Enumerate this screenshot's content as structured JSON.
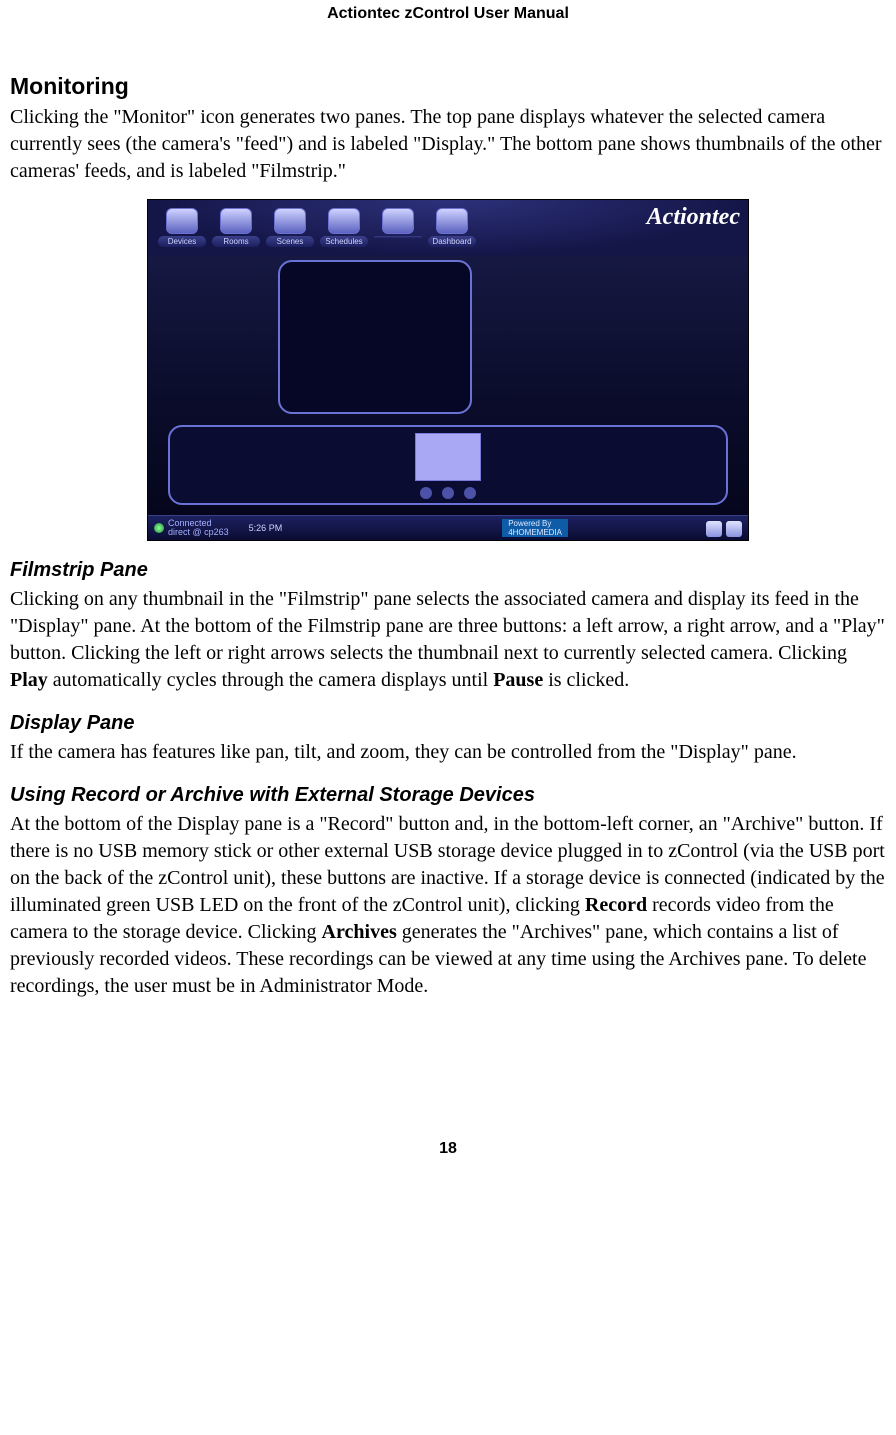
{
  "header": {
    "running_title": "Actiontec zControl User Manual"
  },
  "section": {
    "title": "Monitoring",
    "intro": "Clicking the \"Monitor\" icon generates two panes. The top pane displays whatever the selected camera currently sees (the camera's \"feed\") and is labeled \"Display.\" The bottom pane shows thumbnails of the other cameras' feeds, and is labeled \"Filmstrip.\""
  },
  "screenshot": {
    "brand": "Actiontec",
    "toolbar": [
      "Devices",
      "Rooms",
      "Scenes",
      "Schedules",
      " ",
      "Dashboard"
    ],
    "status": {
      "line1": "Connected",
      "line2": "direct @ cp263",
      "time": "5:26 PM",
      "powered_label": "Powered By",
      "powered_name": "4HOMEMEDIA"
    }
  },
  "filmstrip": {
    "title": "Filmstrip Pane",
    "para_a": "Clicking on any thumbnail in the \"Filmstrip\" pane selects the associated camera and display its feed in the \"Display\" pane. At the bottom of the Filmstrip pane are three buttons: a left arrow, a right arrow, and a \"Play\" button. Clicking the left or right arrows selects the thumbnail next to currently selected camera. Clicking ",
    "bold_a": "Play",
    "para_b": " automatically cycles through the camera displays until ",
    "bold_b": "Pause",
    "para_c": " is clicked."
  },
  "display": {
    "title": "Display Pane",
    "para": "If the camera has features like pan, tilt, and zoom, they can be controlled from the \"Display\" pane."
  },
  "record": {
    "title": "Using Record or Archive with External Storage Devices",
    "para_a": "At the bottom of the Display pane is a \"Record\" button and, in the bottom-left corner, an \"Archive\" button. If there is no USB memory stick or other external USB storage device plugged in to zControl (via the USB port on the back of the zControl unit), these buttons are inactive. If a storage device is connected (indicated by the illuminated green USB LED on the front of the zControl unit), clicking ",
    "bold_a": "Record",
    "para_b": " records video from the camera to the storage device. Clicking ",
    "bold_b": "Archives",
    "para_c": " generates the \"Archives\" pane, which contains a list of previously recorded videos. These recordings can be viewed at any time using the Archives pane. To delete recordings, the user must be in Administrator Mode."
  },
  "page_number": "18"
}
